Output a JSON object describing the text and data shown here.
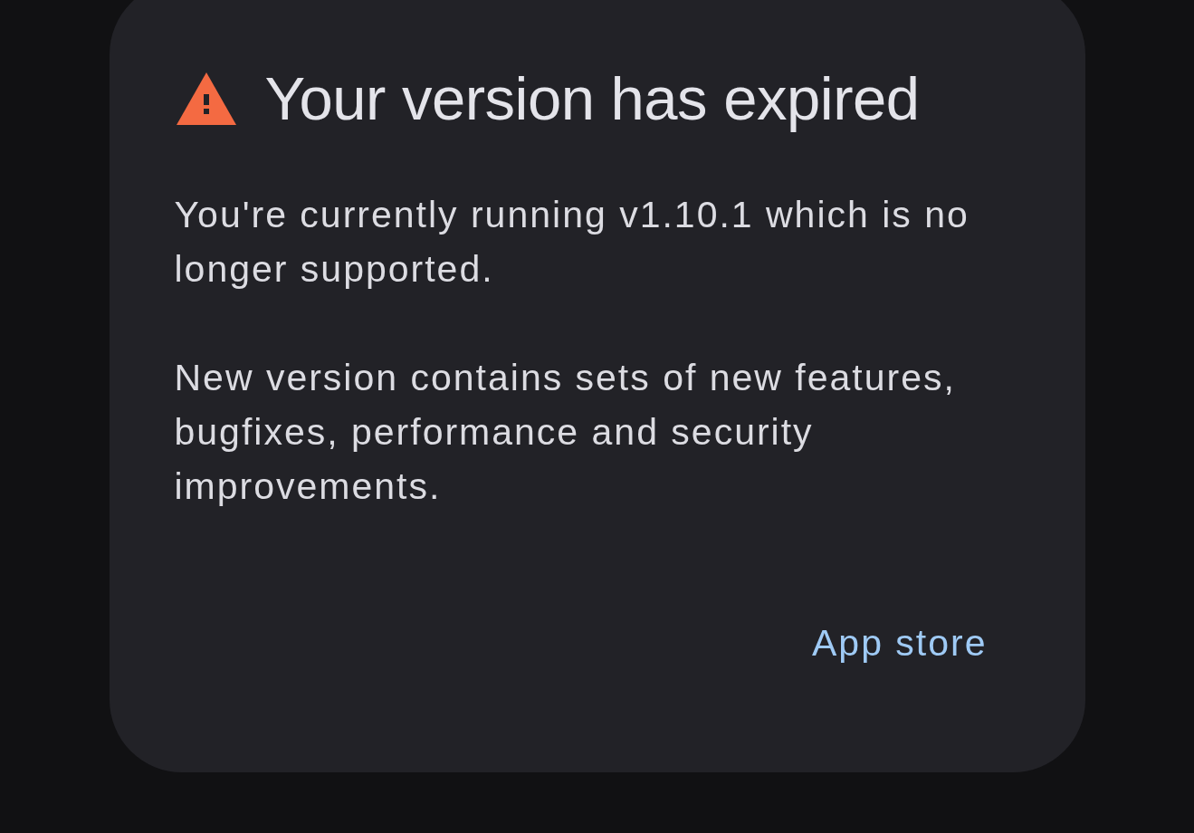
{
  "dialog": {
    "title": "Your version has expired",
    "paragraphs": [
      "You're currently running v1.10.1 which is no longer supported.",
      "New version contains sets of new features, bugfixes, performance and security improvements."
    ],
    "buttons": [
      "App store"
    ]
  }
}
